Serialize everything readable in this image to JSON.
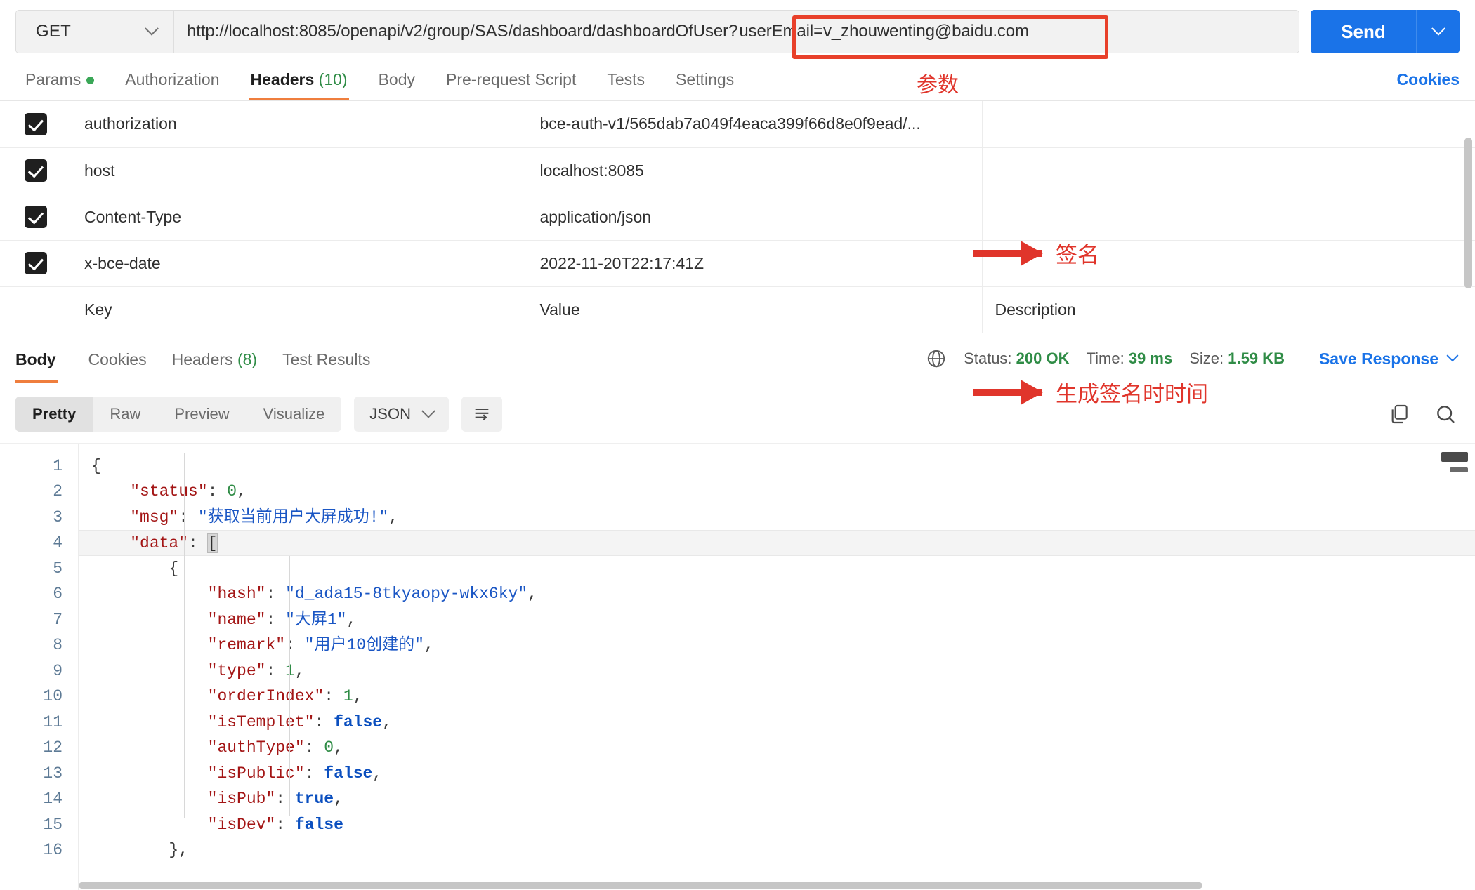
{
  "request": {
    "method": "GET",
    "method_caret": "chevron-down-icon",
    "url_base": "http://localhost:8085/openapi/v2/group/SAS/dashboard/dashboardOfUser",
    "url_query_sep": "?",
    "url_query": "userEmail=v_zhouwenting@baidu.com",
    "param_annotation": "参数",
    "send_label": "Send",
    "send_caret": "chevron-down-icon"
  },
  "request_tabs": [
    {
      "label": "Params",
      "dot": true,
      "active": false
    },
    {
      "label": "Authorization",
      "active": false
    },
    {
      "label": "Headers",
      "count": "(10)",
      "active": true
    },
    {
      "label": "Body",
      "active": false
    },
    {
      "label": "Pre-request Script",
      "active": false
    },
    {
      "label": "Tests",
      "active": false
    },
    {
      "label": "Settings",
      "active": false
    }
  ],
  "cookies_link": "Cookies",
  "headers_table": {
    "placeholders": {
      "key": "Key",
      "value": "Value",
      "description": "Description"
    },
    "rows": [
      {
        "checked": true,
        "key": "authorization",
        "value": "bce-auth-v1/565dab7a049f4eaca399f66d8e0f9ead/...",
        "description": ""
      },
      {
        "checked": true,
        "key": "host",
        "value": "localhost:8085",
        "description": ""
      },
      {
        "checked": true,
        "key": "Content-Type",
        "value": "application/json",
        "description": ""
      },
      {
        "checked": true,
        "key": "x-bce-date",
        "value": "2022-11-20T22:17:41Z",
        "description": ""
      }
    ]
  },
  "annotations": [
    {
      "text": "签名",
      "target": "authorization-row"
    },
    {
      "text": "生成签名时时间",
      "target": "x-bce-date-row"
    }
  ],
  "response_tabs": [
    {
      "label": "Body",
      "active": true
    },
    {
      "label": "Cookies",
      "active": false
    },
    {
      "label": "Headers",
      "count": "(8)",
      "active": false
    },
    {
      "label": "Test Results",
      "active": false
    }
  ],
  "response_meta": {
    "globe_icon": "globe-icon",
    "status_label": "Status:",
    "status_value": "200 OK",
    "time_label": "Time:",
    "time_value": "39 ms",
    "size_label": "Size:",
    "size_value": "1.59 KB",
    "save_response": "Save Response",
    "save_caret": "chevron-down-icon"
  },
  "body_toolbar": {
    "views": [
      {
        "label": "Pretty",
        "active": true
      },
      {
        "label": "Raw",
        "active": false
      },
      {
        "label": "Preview",
        "active": false
      },
      {
        "label": "Visualize",
        "active": false
      }
    ],
    "format": "JSON",
    "format_caret": "chevron-down-icon",
    "wrap_icon": "wrap-lines-icon",
    "copy_icon": "copy-icon",
    "search_icon": "search-icon"
  },
  "response_body": {
    "line_numbers": [
      "1",
      "2",
      "3",
      "4",
      "5",
      "6",
      "7",
      "8",
      "9",
      "10",
      "11",
      "12",
      "13",
      "14",
      "15",
      "16"
    ],
    "lines": [
      {
        "n": 1,
        "indent": 0,
        "tokens": [
          {
            "t": "{",
            "c": "p"
          }
        ]
      },
      {
        "n": 2,
        "indent": 1,
        "tokens": [
          {
            "t": "\"status\"",
            "c": "k"
          },
          {
            "t": ": ",
            "c": "p"
          },
          {
            "t": "0",
            "c": "n"
          },
          {
            "t": ",",
            "c": "p"
          }
        ]
      },
      {
        "n": 3,
        "indent": 1,
        "tokens": [
          {
            "t": "\"msg\"",
            "c": "k"
          },
          {
            "t": ": ",
            "c": "p"
          },
          {
            "t": "\"获取当前用户大屏成功!\"",
            "c": "s"
          },
          {
            "t": ",",
            "c": "p"
          }
        ]
      },
      {
        "n": 4,
        "indent": 1,
        "highlight": true,
        "tokens": [
          {
            "t": "\"data\"",
            "c": "k"
          },
          {
            "t": ": ",
            "c": "p"
          },
          {
            "t": "[",
            "c": "brkt"
          }
        ]
      },
      {
        "n": 5,
        "indent": 2,
        "tokens": [
          {
            "t": "{",
            "c": "p"
          }
        ]
      },
      {
        "n": 6,
        "indent": 3,
        "tokens": [
          {
            "t": "\"hash\"",
            "c": "k"
          },
          {
            "t": ": ",
            "c": "p"
          },
          {
            "t": "\"d_ada15-8tkyaopy-wkx6ky\"",
            "c": "s"
          },
          {
            "t": ",",
            "c": "p"
          }
        ]
      },
      {
        "n": 7,
        "indent": 3,
        "tokens": [
          {
            "t": "\"name\"",
            "c": "k"
          },
          {
            "t": ": ",
            "c": "p"
          },
          {
            "t": "\"大屏1\"",
            "c": "s"
          },
          {
            "t": ",",
            "c": "p"
          }
        ]
      },
      {
        "n": 8,
        "indent": 3,
        "tokens": [
          {
            "t": "\"remark\"",
            "c": "k"
          },
          {
            "t": ": ",
            "c": "p"
          },
          {
            "t": "\"用户10创建的\"",
            "c": "s"
          },
          {
            "t": ",",
            "c": "p"
          }
        ]
      },
      {
        "n": 9,
        "indent": 3,
        "tokens": [
          {
            "t": "\"type\"",
            "c": "k"
          },
          {
            "t": ": ",
            "c": "p"
          },
          {
            "t": "1",
            "c": "n"
          },
          {
            "t": ",",
            "c": "p"
          }
        ]
      },
      {
        "n": 10,
        "indent": 3,
        "tokens": [
          {
            "t": "\"orderIndex\"",
            "c": "k"
          },
          {
            "t": ": ",
            "c": "p"
          },
          {
            "t": "1",
            "c": "n"
          },
          {
            "t": ",",
            "c": "p"
          }
        ]
      },
      {
        "n": 11,
        "indent": 3,
        "tokens": [
          {
            "t": "\"isTemplet\"",
            "c": "k"
          },
          {
            "t": ": ",
            "c": "p"
          },
          {
            "t": "false",
            "c": "b"
          },
          {
            "t": ",",
            "c": "p"
          }
        ]
      },
      {
        "n": 12,
        "indent": 3,
        "tokens": [
          {
            "t": "\"authType\"",
            "c": "k"
          },
          {
            "t": ": ",
            "c": "p"
          },
          {
            "t": "0",
            "c": "n"
          },
          {
            "t": ",",
            "c": "p"
          }
        ]
      },
      {
        "n": 13,
        "indent": 3,
        "tokens": [
          {
            "t": "\"isPublic\"",
            "c": "k"
          },
          {
            "t": ": ",
            "c": "p"
          },
          {
            "t": "false",
            "c": "b"
          },
          {
            "t": ",",
            "c": "p"
          }
        ]
      },
      {
        "n": 14,
        "indent": 3,
        "tokens": [
          {
            "t": "\"isPub\"",
            "c": "k"
          },
          {
            "t": ": ",
            "c": "p"
          },
          {
            "t": "true",
            "c": "b"
          },
          {
            "t": ",",
            "c": "p"
          }
        ]
      },
      {
        "n": 15,
        "indent": 3,
        "tokens": [
          {
            "t": "\"isDev\"",
            "c": "k"
          },
          {
            "t": ": ",
            "c": "p"
          },
          {
            "t": "false",
            "c": "b"
          }
        ]
      },
      {
        "n": 16,
        "indent": 2,
        "tokens": [
          {
            "t": "},",
            "c": "p"
          }
        ]
      }
    ]
  },
  "colors": {
    "accent_blue": "#1a73e8",
    "tab_underline": "#ef7e3d",
    "annotation_red": "#e0352b",
    "success_green": "#2f8c46"
  }
}
